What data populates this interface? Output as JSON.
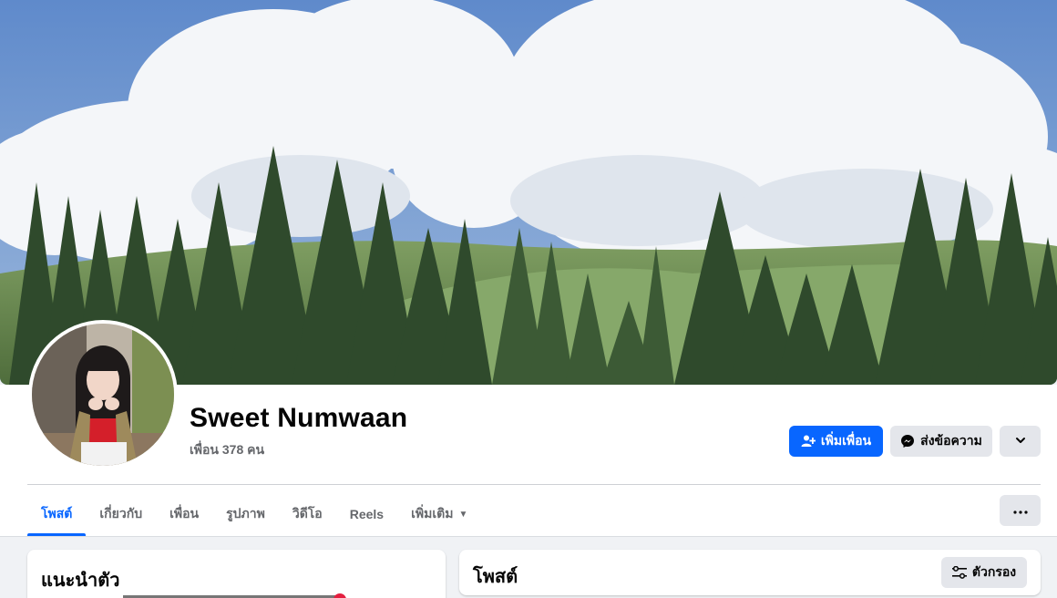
{
  "profile": {
    "name": "Sweet Numwaan",
    "friend_count": "เพื่อน 378 คน"
  },
  "actions": {
    "add_friend": "เพิ่มเพื่อน",
    "message": "ส่งข้อความ"
  },
  "tabs": [
    {
      "label": "โพสต์",
      "active": true
    },
    {
      "label": "เกี่ยวกับ",
      "active": false
    },
    {
      "label": "เพื่อน",
      "active": false
    },
    {
      "label": "รูปภาพ",
      "active": false
    },
    {
      "label": "วิดีโอ",
      "active": false
    },
    {
      "label": "Reels",
      "active": false
    },
    {
      "label": "เพิ่มเติม",
      "active": false
    }
  ],
  "intro": {
    "title": "แนะนำตัว"
  },
  "posts": {
    "title": "โพสต์",
    "filter_label": "ตัวกรอง"
  },
  "colors": {
    "primary": "#0866ff",
    "secondary_button": "#e4e6eb",
    "page_background": "#f0f2f5",
    "muted_text": "#65676b",
    "notification_dot": "#e41e3f"
  },
  "icons": {
    "add_friend": "person-add-icon",
    "message": "messenger-icon",
    "dropdown": "chevron-down-icon",
    "more": "more-dots-icon",
    "filter": "sliders-icon",
    "tab_more": "caret-down-icon"
  }
}
